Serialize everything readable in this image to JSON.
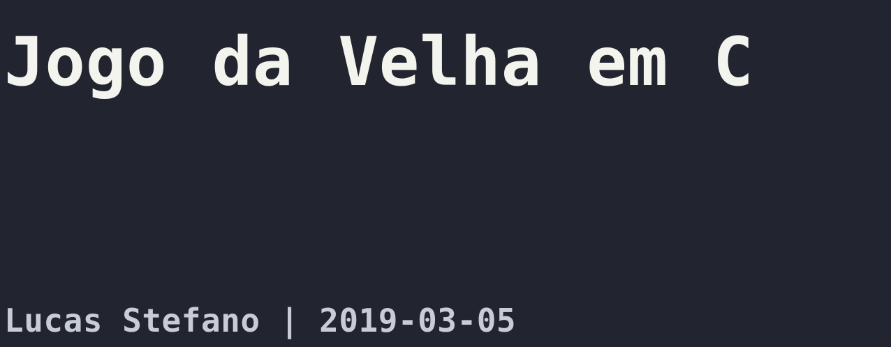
{
  "post": {
    "title": "Jogo da Velha em C",
    "author": "Lucas Stefano",
    "separator": "|",
    "date": "2019-03-05"
  }
}
